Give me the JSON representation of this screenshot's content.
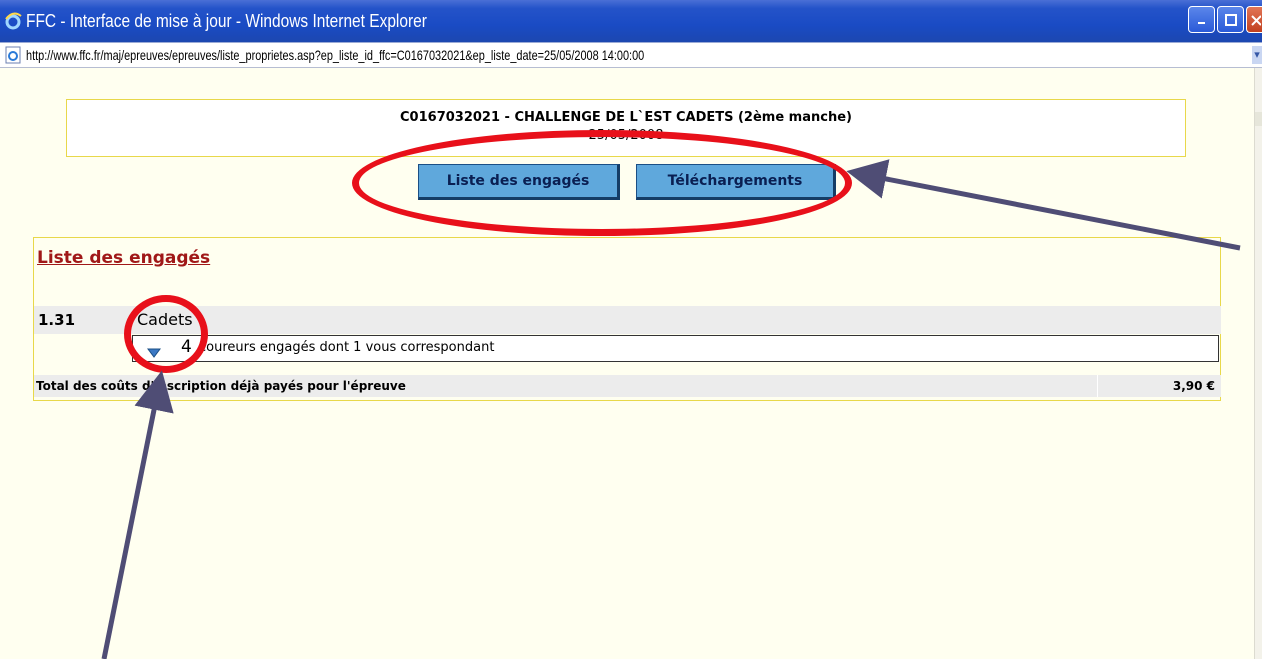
{
  "window": {
    "title": "FFC - Interface de mise à jour - Windows Internet Explorer",
    "icon": "ie-icon"
  },
  "address": {
    "url": "http://www.ffc.fr/maj/epreuves/epreuves/liste_proprietes.asp?ep_liste_id_ffc=C0167032021&ep_liste_date=25/05/2008 14:00:00"
  },
  "event": {
    "title": "C0167032021 - CHALLENGE DE L`EST CADETS (2ème manche)",
    "date": "25/05/2008"
  },
  "tabs": {
    "engages_label": "Liste des engagés",
    "telechargements_label": "Téléchargements"
  },
  "panel": {
    "title": "Liste des engagés",
    "category": {
      "code": "1.31",
      "name": "Cadets",
      "count": "4",
      "runners_text": "coureurs engagés dont 1 vous correspondant"
    },
    "total": {
      "label": "Total des coûts d'inscription déjà payés pour l'épreuve",
      "value": "3,90 €"
    }
  },
  "colors": {
    "titlebar": "#1a4bc4",
    "button": "#5fa8dc",
    "annotation": "#e8101a",
    "panel_title": "#a01818"
  }
}
